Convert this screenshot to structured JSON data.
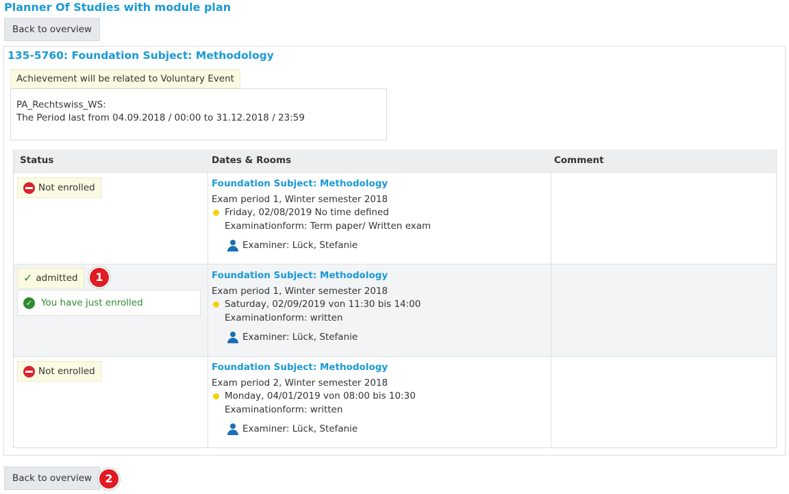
{
  "page": {
    "title": "Planner Of Studies with module plan",
    "back_label": "Back to overview"
  },
  "module": {
    "title": "135-5760: Foundation Subject: Methodology",
    "achievement_note": "Achievement will be related to Voluntary Event",
    "period_name": "PA_Rechtswiss_WS:",
    "period_text": "The Period last from 04.09.2018 / 00:00 to 31.12.2018 / 23:59"
  },
  "table": {
    "headers": [
      "Status",
      "Dates & Rooms",
      "Comment"
    ],
    "rows": [
      {
        "status": "Not enrolled",
        "event": "Foundation Subject: Methodology",
        "exam_period": "Exam period 1, Winter semester 2018",
        "date": "Friday, 02/08/2019 No time defined",
        "form": "Examinationform: Term paper/ Written exam",
        "examiner": "Examiner: Lück, Stefanie",
        "comment": ""
      },
      {
        "status": "admitted",
        "success_message": "You have just enrolled",
        "event": "Foundation Subject: Methodology",
        "exam_period": "Exam period 1, Winter semester 2018",
        "date": "Saturday, 02/09/2019 von 11:30 bis 14:00",
        "form": "Examinationform: written",
        "examiner": "Examiner: Lück, Stefanie",
        "comment": ""
      },
      {
        "status": "Not enrolled",
        "event": "Foundation Subject: Methodology",
        "exam_period": "Exam period 2, Winter semester 2018",
        "date": "Monday, 04/01/2019 von 08:00 bis 10:30",
        "form": "Examinationform: written",
        "examiner": "Examiner: Lück, Stefanie",
        "comment": ""
      }
    ]
  },
  "markers": [
    "1",
    "2"
  ],
  "colors": {
    "link": "#1a9ad6",
    "success": "#2e8b2e",
    "error": "#d9232e",
    "marker": "#e01b24",
    "date_dot": "#f6d100"
  },
  "icons": [
    "no-entry-icon",
    "checkmark-icon",
    "success-circle-icon",
    "calendar-dot-icon",
    "person-icon"
  ]
}
